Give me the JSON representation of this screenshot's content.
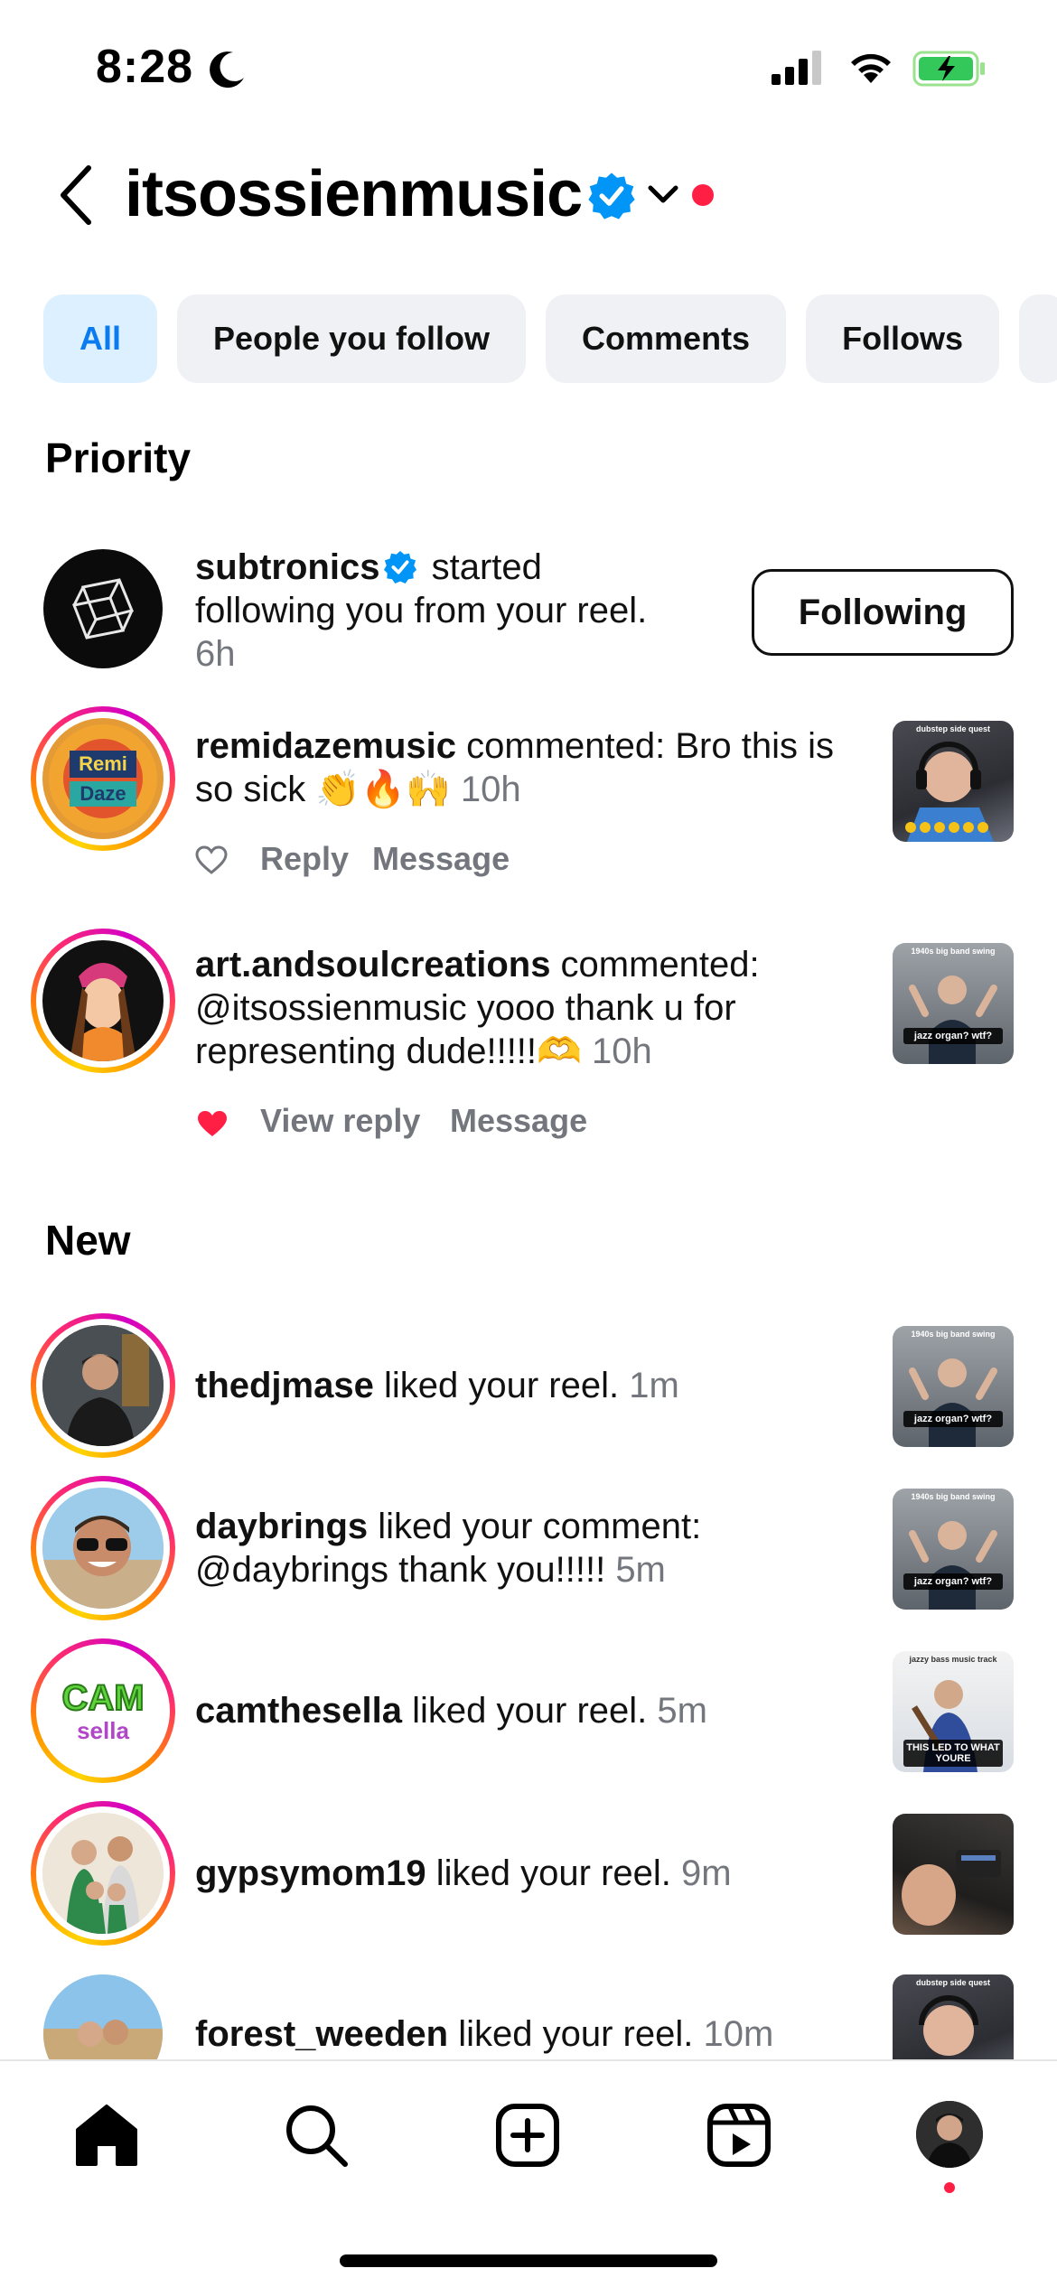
{
  "status_bar": {
    "time": "8:28"
  },
  "header": {
    "username": "itsossienmusic"
  },
  "filters": [
    {
      "label": "All",
      "active": true
    },
    {
      "label": "People you follow",
      "active": false
    },
    {
      "label": "Comments",
      "active": false
    },
    {
      "label": "Follows",
      "active": false
    }
  ],
  "sections": {
    "priority": "Priority",
    "new": "New"
  },
  "priority": [
    {
      "username": "subtronics",
      "text": " started following you from your reel.",
      "time": "6h",
      "button": "Following"
    },
    {
      "username": "remidazemusic",
      "text": " commented: Bro this is so sick 👏🔥🙌",
      "time": "10h",
      "actions": [
        "Reply",
        "Message"
      ],
      "thumb_caption": "dubstep side quest"
    },
    {
      "username": "art.andsoulcreations",
      "text": " commented: @itsossienmusic yooo thank u for representing dude!!!!!🫶",
      "time": "10h",
      "actions": [
        "View reply",
        "Message"
      ],
      "thumb_caption": "1940s big band swing",
      "thumb_label": "jazz organ? wtf?"
    }
  ],
  "new": [
    {
      "username": "thedjmase",
      "text": " liked your reel.",
      "time": "1m",
      "thumb_caption": "1940s big band swing",
      "thumb_label": "jazz organ? wtf?"
    },
    {
      "username": "daybrings",
      "text": " liked your comment: @daybrings thank you!!!!!",
      "time": "5m",
      "thumb_caption": "1940s big band swing",
      "thumb_label": "jazz organ? wtf?"
    },
    {
      "username": "camthesella",
      "text": " liked your reel.",
      "time": "5m",
      "thumb_caption": "jazzy bass music track",
      "thumb_label": "THIS LED TO WHAT YOURE"
    },
    {
      "username": "gypsymom19",
      "text": " liked your reel.",
      "time": "9m"
    },
    {
      "username": "forest_weeden",
      "text": " liked your reel.",
      "time": "10m",
      "thumb_caption": "dubstep side quest"
    }
  ],
  "colors": {
    "accent_blue": "#0a7cf0",
    "verified_blue": "#0095f6",
    "notification_red": "#ff1f44",
    "muted_text": "#73767c",
    "chip_bg": "#eff1f4",
    "chip_active_bg": "#ddf0ff"
  },
  "icons": {
    "status": [
      "moon-icon",
      "signal-icon",
      "wifi-icon",
      "battery-charging-icon"
    ],
    "header": [
      "back-icon",
      "verified-badge-icon",
      "chevron-down-icon"
    ],
    "nav": [
      "home-icon",
      "search-icon",
      "create-icon",
      "reels-icon",
      "profile-avatar"
    ]
  }
}
